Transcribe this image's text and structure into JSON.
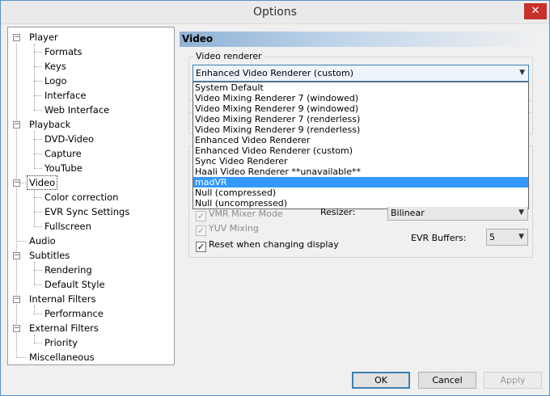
{
  "window": {
    "title": "Options",
    "close_glyph": "✕"
  },
  "tree": {
    "player": "Player",
    "formats": "Formats",
    "keys": "Keys",
    "logo": "Logo",
    "interface": "Interface",
    "web_interface": "Web Interface",
    "playback": "Playback",
    "dvd_video": "DVD-Video",
    "capture": "Capture",
    "youtube": "YouTube",
    "video": "Video",
    "color_correction": "Color correction",
    "evr_sync": "EVR Sync Settings",
    "fullscreen": "Fullscreen",
    "audio": "Audio",
    "subtitles": "Subtitles",
    "rendering": "Rendering",
    "default_style": "Default Style",
    "internal_filters": "Internal Filters",
    "performance": "Performance",
    "external_filters": "External Filters",
    "priority": "Priority",
    "miscellaneous": "Miscellaneous",
    "collapse_glyph": "−"
  },
  "panel": {
    "header": "Video",
    "renderer_group": "Video renderer",
    "renderer_selected": "Enhanced Video Renderer (custom)",
    "arrow_glyph": "▼",
    "dropdown_options": [
      "System Default",
      "Video Mixing Renderer 7 (windowed)",
      "Video Mixing Renderer 9 (windowed)",
      "Video Mixing Renderer 7 (renderless)",
      "Video Mixing Renderer 9 (renderless)",
      "Enhanced Video Renderer",
      "Enhanced Video Renderer (custom)",
      "Sync Video Renderer",
      "Haali Video Renderer **unavailable**",
      "madVR",
      "Null (compressed)",
      "Null (uncompressed)"
    ],
    "highlighted_option": "madVR",
    "vmr_mixer_mode": "VMR Mixer Mode",
    "yuv_mixing": "YUV Mixing",
    "reset_display": "Reset when changing display",
    "check_glyph": "✓",
    "resizer_label": "Resizer:",
    "resizer_value": "Bilinear",
    "evr_buffers_label": "EVR Buffers:",
    "evr_buffers_value": "5"
  },
  "buttons": {
    "ok": "OK",
    "cancel": "Cancel",
    "apply": "Apply"
  },
  "colors": {
    "accent": "#3c7fb1",
    "highlight": "#3399ff",
    "close": "#c7302b"
  }
}
